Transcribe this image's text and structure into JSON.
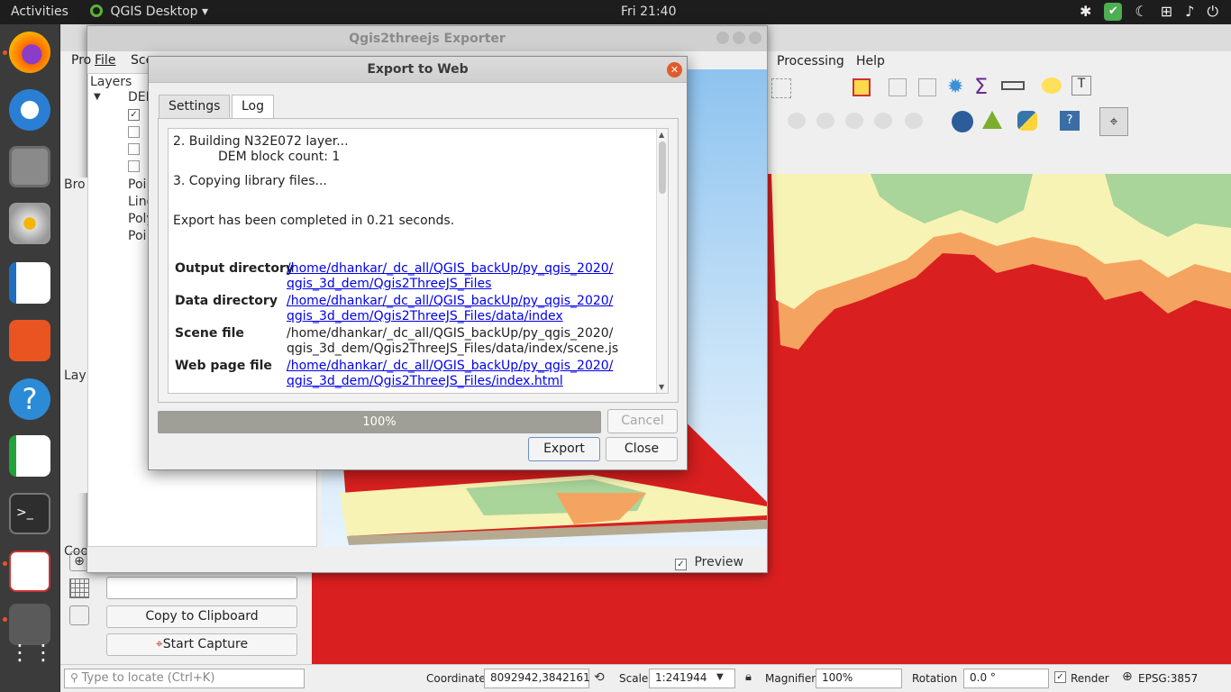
{
  "topbar": {
    "activities": "Activities",
    "app_name": "QGIS Desktop",
    "app_menu_arrow": "▾",
    "clock": "Fri 21:40",
    "tray_icons": [
      "slack-icon",
      "update-check-icon",
      "night-light-icon",
      "network-icon",
      "volume-icon",
      "power-icon"
    ]
  },
  "dock": {
    "icons": [
      "firefox-icon",
      "thunderbird-icon",
      "files-icon",
      "rhythmbox-icon",
      "writer-icon",
      "software-center-icon",
      "help-icon",
      "calc-icon",
      "terminal-icon",
      "document-viewer-icon",
      "qgis-icon",
      "show-applications-icon"
    ]
  },
  "qgis": {
    "menu_processing": "Processing",
    "menu_help": "Help",
    "panels": {
      "layers_label": "Layers",
      "dem_label": "DEM",
      "browser_label": "Bro",
      "point_label": "Poi",
      "line_label": "Line",
      "poly_label": "Poly",
      "point2_label": "Poi",
      "layer_styling_label": "Lay",
      "coord_label": "Coo"
    },
    "copy_clipboard": "Copy to Clipboard",
    "start_capture": "Start Capture",
    "status": {
      "locate_placeholder": "Type to locate (Ctrl+K)",
      "coordinate_label": "Coordinate",
      "coordinate_value": "8092942,3842161",
      "scale_label": "Scale",
      "scale_value": "1:241944",
      "magnifier_label": "Magnifier",
      "magnifier_value": "100%",
      "rotation_label": "Rotation",
      "rotation_value": "0.0 °",
      "render_label": "Render",
      "crs_label": "EPSG:3857"
    }
  },
  "exporter": {
    "title": "Qgis2threejs Exporter",
    "menu_file": "File",
    "menu_scene": "Sce",
    "menu_partial": "Pro",
    "preview_label": "Preview"
  },
  "dialog": {
    "title": "Export to Web",
    "tabs": [
      "Settings",
      "Log"
    ],
    "active_tab": "Log",
    "log": {
      "line1": "2. Building N32E072 layer...",
      "line2": "DEM block count: 1",
      "line3": "3. Copying library files...",
      "line4": "Export has been completed in 0.21 seconds.",
      "rows": [
        {
          "key": "Output directory",
          "v1": "/home/dhankar/_dc_all/QGIS_backUp/py_qgis_2020/",
          "v2": "qgis_3d_dem/Qgis2ThreeJS_Files",
          "link": true
        },
        {
          "key": "Data directory",
          "v1": "/home/dhankar/_dc_all/QGIS_backUp/py_qgis_2020/",
          "v2": "qgis_3d_dem/Qgis2ThreeJS_Files/data/index",
          "link": true
        },
        {
          "key": "Scene file",
          "v1": "/home/dhankar/_dc_all/QGIS_backUp/py_qgis_2020/",
          "v2": "qgis_3d_dem/Qgis2ThreeJS_Files/data/index/scene.js",
          "link": false
        },
        {
          "key": "Web page file",
          "v1": "/home/dhankar/_dc_all/QGIS_backUp/py_qgis_2020/",
          "v2": "qgis_3d_dem/Qgis2ThreeJS_Files/index.html",
          "link": true
        }
      ]
    },
    "progress_text": "100%",
    "progress_value": 1.0,
    "cancel_label": "Cancel",
    "export_label": "Export",
    "close_label": "Close"
  },
  "colors": {
    "map_red": "#d91f1f",
    "dem_orange": "#f4a460",
    "dem_yellow": "#f7f3b4",
    "dem_green": "#a9d49a",
    "progress_fill": "#a09f97",
    "link_blue": "#0000ee"
  }
}
